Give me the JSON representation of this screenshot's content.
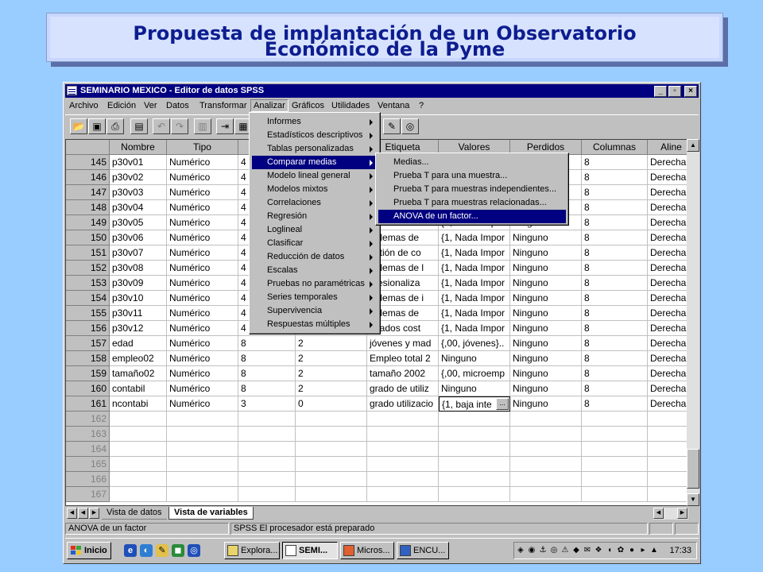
{
  "slide": {
    "title_line1": "Propuesta de implantación de un Observatorio",
    "title_line2": "Económico de la Pyme"
  },
  "window": {
    "title": "SEMINARIO MEXICO - Editor de datos SPSS",
    "controls": [
      "_",
      "▫",
      "×"
    ]
  },
  "menubar": [
    "Archivo",
    "Edición",
    "Ver",
    "Datos",
    "Transformar",
    "Analizar",
    "Gráficos",
    "Utilidades",
    "Ventana",
    "?"
  ],
  "grid": {
    "columns": [
      "Nombre",
      "Tipo",
      "",
      "",
      "Etiqueta",
      "Valores",
      "Perdidos",
      "Columnas",
      "Aline"
    ],
    "rows": [
      {
        "num": "145",
        "cells": [
          "p30v01",
          "Numérico",
          "4",
          "",
          "",
          "",
          "",
          "8",
          "Derecha"
        ]
      },
      {
        "num": "146",
        "cells": [
          "p30v02",
          "Numérico",
          "4",
          "",
          "",
          "",
          "",
          "8",
          "Derecha"
        ]
      },
      {
        "num": "147",
        "cells": [
          "p30v03",
          "Numérico",
          "4",
          "",
          "",
          "",
          "",
          "8",
          "Derecha"
        ]
      },
      {
        "num": "148",
        "cells": [
          "p30v04",
          "Numérico",
          "4",
          "",
          "",
          "",
          "",
          "8",
          "Derecha"
        ]
      },
      {
        "num": "149",
        "cells": [
          "p30v05",
          "Numérico",
          "4",
          "",
          "oblemas bur",
          "{1, Nada Impor",
          "Ninguno",
          "8",
          "Derecha"
        ]
      },
      {
        "num": "150",
        "cells": [
          "p30v06",
          "Numérico",
          "4",
          "",
          "oblemas de",
          "{1, Nada Impor",
          "Ninguno",
          "8",
          "Derecha"
        ]
      },
      {
        "num": "151",
        "cells": [
          "p30v07",
          "Numérico",
          "4",
          "",
          "estión de co",
          "{1, Nada Impor",
          "Ninguno",
          "8",
          "Derecha"
        ]
      },
      {
        "num": "152",
        "cells": [
          "p30v08",
          "Numérico",
          "4",
          "",
          "oblemas de l",
          "{1, Nada Impor",
          "Ninguno",
          "8",
          "Derecha"
        ]
      },
      {
        "num": "153",
        "cells": [
          "p30v09",
          "Numérico",
          "4",
          "",
          "ofesionaliza",
          "{1, Nada Impor",
          "Ninguno",
          "8",
          "Derecha"
        ]
      },
      {
        "num": "154",
        "cells": [
          "p30v10",
          "Numérico",
          "4",
          "",
          "oblemas de i",
          "{1, Nada Impor",
          "Ninguno",
          "8",
          "Derecha"
        ]
      },
      {
        "num": "155",
        "cells": [
          "p30v11",
          "Numérico",
          "4",
          "",
          "oblemas de",
          "{1, Nada Impor",
          "Ninguno",
          "8",
          "Derecha"
        ]
      },
      {
        "num": "156",
        "cells": [
          "p30v12",
          "Numérico",
          "4",
          "",
          "evados cost",
          "{1, Nada Impor",
          "Ninguno",
          "8",
          "Derecha"
        ]
      },
      {
        "num": "157",
        "cells": [
          "edad",
          "Numérico",
          "8",
          "2",
          "jóvenes y mad",
          "{,00, jóvenes}..",
          "Ninguno",
          "8",
          "Derecha"
        ]
      },
      {
        "num": "158",
        "cells": [
          "empleo02",
          "Numérico",
          "8",
          "2",
          "Empleo total 2",
          "Ninguno",
          "Ninguno",
          "8",
          "Derecha"
        ]
      },
      {
        "num": "159",
        "cells": [
          "tamaño02",
          "Numérico",
          "8",
          "2",
          "tamaño 2002",
          "{,00, microemp",
          "Ninguno",
          "8",
          "Derecha"
        ]
      },
      {
        "num": "160",
        "cells": [
          "contabil",
          "Numérico",
          "8",
          "2",
          "grado de utiliz",
          "Ninguno",
          "Ninguno",
          "8",
          "Derecha"
        ]
      },
      {
        "num": "161",
        "cells": [
          "ncontabi",
          "Numérico",
          "3",
          "0",
          "grado utilizacio",
          "{1, baja inte",
          "Ninguno",
          "8",
          "Derecha"
        ]
      }
    ],
    "empty_rows": [
      "162",
      "163",
      "164",
      "165",
      "166",
      "167"
    ],
    "selected_cell_button": "..."
  },
  "analizar_menu": [
    {
      "label": "Informes",
      "arrow": true
    },
    {
      "label": "Estadísticos descriptivos",
      "arrow": true
    },
    {
      "label": "Tablas personalizadas",
      "arrow": true
    },
    {
      "label": "Comparar medias",
      "arrow": true,
      "highlight": true
    },
    {
      "label": "Modelo lineal general",
      "arrow": true
    },
    {
      "label": "Modelos mixtos",
      "arrow": true
    },
    {
      "label": "Correlaciones",
      "arrow": true
    },
    {
      "label": "Regresión",
      "arrow": true
    },
    {
      "label": "Loglineal",
      "arrow": true
    },
    {
      "label": "Clasificar",
      "arrow": true
    },
    {
      "label": "Reducción de datos",
      "arrow": true
    },
    {
      "label": "Escalas",
      "arrow": true
    },
    {
      "label": "Pruebas no paramétricas",
      "arrow": true
    },
    {
      "label": "Series temporales",
      "arrow": true
    },
    {
      "label": "Supervivencia",
      "arrow": true
    },
    {
      "label": "Respuestas múltiples",
      "arrow": true
    }
  ],
  "comparar_submenu": [
    {
      "label": "Medias..."
    },
    {
      "label": "Prueba T para una muestra..."
    },
    {
      "label": "Prueba T para muestras independientes..."
    },
    {
      "label": "Prueba T para muestras relacionadas..."
    },
    {
      "label": "ANOVA de un factor...",
      "highlight": true
    }
  ],
  "tabs": {
    "data_view": "Vista de datos",
    "variable_view": "Vista de variables"
  },
  "status": {
    "left": "ANOVA de un factor",
    "right": "SPSS  El procesador  está preparado"
  },
  "taskbar": {
    "start": "Inicio",
    "tasks": [
      "Explora...",
      "SEMI...",
      "Micros...",
      "ENCU..."
    ],
    "clock": "17:33"
  },
  "colors": {
    "desktop": "#99ccff",
    "title_text": "#0d1d90",
    "titlebar": "#000080",
    "menu_highlight": "#000080"
  }
}
